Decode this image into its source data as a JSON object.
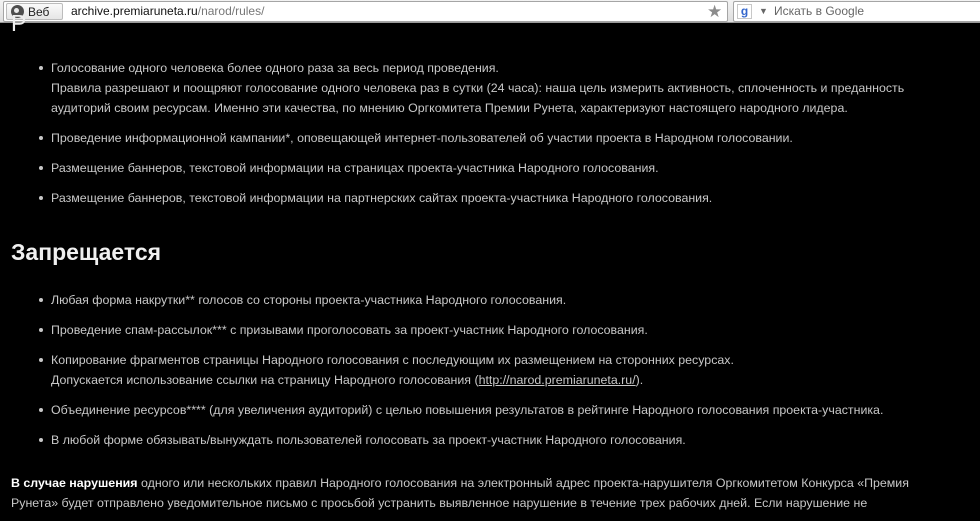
{
  "browser": {
    "web_label": "Веб",
    "url_host": "archive.premiaruneta.ru",
    "url_path": "/narod/rules/",
    "search_placeholder": "Искать в Google"
  },
  "page": {
    "list1": [
      {
        "line1": "Голосование одного человека более одного раза за весь период проведения.",
        "line2": "Правила разрешают и поощряют голосование одного человека раз в сутки (24 часа): наша цель измерить активность, сплоченность и преданность",
        "line3": "аудиторий своим ресурсам. Именно эти качества, по мнению Оргкомитета Премии Рунета, характеризуют настоящего народного лидера."
      },
      {
        "line1": "Проведение информационной кампании*, оповещающей интернет-пользователей об участии проекта в Народном голосовании."
      },
      {
        "line1": "Размещение баннеров, текстовой информации на страницах проекта-участника Народного голосования."
      },
      {
        "line1": "Размещение баннеров, текстовой информации на партнерских сайтах проекта-участника Народного голосования."
      }
    ],
    "heading_forbidden": "Запрещается",
    "list2": [
      {
        "line1": "Любая форма накрутки** голосов со стороны проекта-участника Народного голосования."
      },
      {
        "line1": "Проведение спам-рассылок*** с призывами проголосовать за проект-участник Народного голосования."
      },
      {
        "line1": "Копирование фрагментов страницы Народного голосования с последующим их размещением на сторонних ресурсах.",
        "line2_prefix": "Допускается использование ссылки на страницу Народного голосования (",
        "line2_link": "http://narod.premiaruneta.ru/",
        "line2_suffix": ")."
      },
      {
        "line1": "Объединение ресурсов**** (для увеличения аудиторий) с целью повышения результатов в рейтинге Народного голосования проекта-участника."
      },
      {
        "line1": "В любой форме обязывать/вынуждать пользователей голосовать за проект-участник Народного голосования."
      }
    ],
    "violation_lead": "В случае нарушения",
    "violation_text": " одного или нескольких правил Народного голосования на электронный адрес проекта-нарушителя Оргкомитетом Конкурса «Премия",
    "violation_text2": "Рунета» будет отправлено уведомительное письмо с просьбой устранить выявленное нарушение в течение трех рабочих дней. Если нарушение не"
  }
}
